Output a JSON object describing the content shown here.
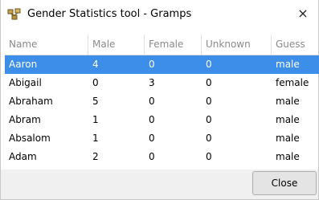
{
  "window": {
    "title": "Gender Statistics tool - Gramps",
    "close_glyph": "×"
  },
  "table": {
    "columns": [
      "Name",
      "Male",
      "Female",
      "Unknown",
      "Guess"
    ],
    "rows": [
      [
        "Aaron",
        "4",
        "0",
        "0",
        "male"
      ],
      [
        "Abigail",
        "0",
        "3",
        "0",
        "female"
      ],
      [
        "Abraham",
        "5",
        "0",
        "0",
        "male"
      ],
      [
        "Abram",
        "1",
        "0",
        "0",
        "male"
      ],
      [
        "Absalom",
        "1",
        "0",
        "0",
        "male"
      ],
      [
        "Adam",
        "2",
        "0",
        "0",
        "male"
      ]
    ],
    "selected_row": 0
  },
  "footer": {
    "close_label": "Close"
  },
  "colors": {
    "selection": "#3d8ee8",
    "header_text": "#8a8a8a"
  },
  "icons": {
    "app": "gramps-app-icon",
    "close": "close-icon"
  }
}
